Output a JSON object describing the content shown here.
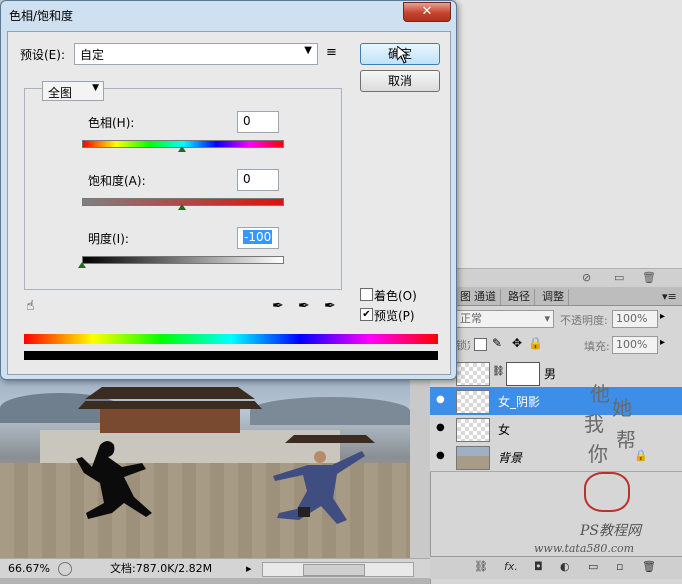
{
  "dialog": {
    "title": "色相/饱和度",
    "close_glyph": "✕",
    "preset_label": "预设(E):",
    "preset_value": "自定",
    "ok_label": "确定",
    "cancel_label": "取消",
    "channel_value": "全图",
    "hue": {
      "label": "色相(H):",
      "value": "0",
      "level": 0.5
    },
    "saturation": {
      "label": "饱和度(A):",
      "value": "0",
      "level": 0.5
    },
    "lightness": {
      "label": "明度(I):",
      "value": "-100",
      "level": 0.0
    },
    "colorize_label": "着色(O)",
    "colorize_checked": false,
    "preview_label": "预览(P)",
    "preview_checked": true,
    "check_glyph": "✔"
  },
  "layers_panel": {
    "tabs": [
      "图层",
      "通道",
      "路径",
      "调整"
    ],
    "blend_mode": "正常",
    "opacity_label": "不透明度:",
    "opacity_value": "100%",
    "fill_label": "填充:",
    "fill_value": "100%",
    "lock_label": "锁定:",
    "layers": [
      {
        "name": "男",
        "selected": false,
        "has_mask": true
      },
      {
        "name": "女_阴影",
        "selected": true,
        "has_mask": false
      },
      {
        "name": "女",
        "selected": false,
        "has_mask": false
      },
      {
        "name": "背景",
        "selected": false,
        "has_mask": false
      }
    ],
    "footer_fx": "fx."
  },
  "statusbar": {
    "zoom": "66.67%",
    "doc_info": "文档:787.0K/2.82M"
  },
  "watermark": {
    "lines": [
      "他",
      "她",
      "我",
      "帮",
      "你"
    ],
    "site_name": "PS教程网",
    "site_url": "www.tata580.com"
  },
  "colors": {
    "selection_blue": "#3d8ee8",
    "title_bar_blue": "#cfe0f0",
    "close_red": "#c4442e"
  },
  "icons": [
    "dropdown-arrow-icon",
    "preset-options-icon",
    "hand-adjust-icon",
    "eyedropper-icon",
    "eyedropper-plus-icon",
    "eyedropper-minus-icon",
    "eye-icon",
    "link-icon",
    "lock-icon"
  ]
}
